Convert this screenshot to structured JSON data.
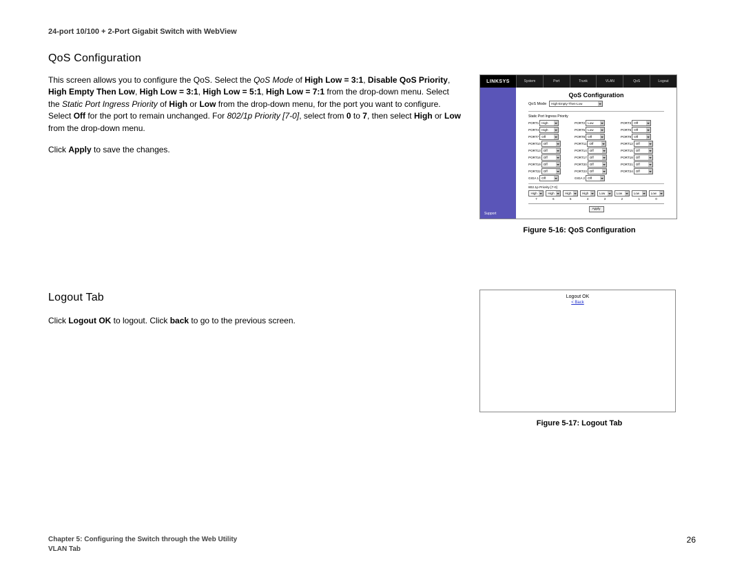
{
  "doc_title": "24-port 10/100 + 2-Port Gigabit Switch with WebView",
  "section1": {
    "heading": "QoS Configuration",
    "p_a": "This screen allows you to configure the QoS. Select the ",
    "p_b": "QoS Mode",
    "p_c": " of ",
    "p_d": "High Low = 3:1",
    "p_e": ", ",
    "p_f": "Disable QoS Priority",
    "p_g": ", ",
    "p_h": "High Empty Then Low",
    "p_i": ", ",
    "p_j": "High Low = 3:1",
    "p_k": ", ",
    "p_l": "High Low = 5:1",
    "p_m": ", ",
    "p_n": "High Low = 7:1",
    "p_o": " from the drop-down menu. Select the ",
    "p_p": "Static Port Ingress Priority",
    "p_q": " of ",
    "p_r": "High",
    "p_s": " or ",
    "p_t": "Low",
    "p_u": " from the drop-down menu, for the port you want to configure. Select ",
    "p_v": "Off",
    "p_w": " for the port to remain unchanged. For ",
    "p_x": "802/1p Priority [7-0]",
    "p_y": ", select from ",
    "p_z": "0",
    "p_aa": " to ",
    "p_ab": "7",
    "p_ac": ", then select ",
    "p_ad": "High",
    "p_ae": " or ",
    "p_af": "Low",
    "p_ag": " from the drop-down menu.",
    "click_a": "Click ",
    "click_b": "Apply",
    "click_c": " to save the changes."
  },
  "fig1": {
    "caption": "Figure 5-16: QoS Configuration",
    "logo": "LINKSYS",
    "tabs": [
      "System",
      "Port",
      "Trunk",
      "VLAN",
      "QoS",
      "Logout"
    ],
    "title": "QoS Configuration",
    "mode_label": "QoS Mode",
    "mode_value": "High-Empty-Then-Low",
    "ingress_label": "Static Port Ingress Priority",
    "ports": [
      {
        "n": "PORT1",
        "v": "High"
      },
      {
        "n": "PORT2",
        "v": "Low"
      },
      {
        "n": "PORT3",
        "v": "Off"
      },
      {
        "n": "PORT4",
        "v": "High"
      },
      {
        "n": "PORT5",
        "v": "Low"
      },
      {
        "n": "PORT6",
        "v": "Off"
      },
      {
        "n": "PORT7",
        "v": "Off"
      },
      {
        "n": "PORT8",
        "v": "Off"
      },
      {
        "n": "PORT9",
        "v": "Off"
      },
      {
        "n": "PORT10",
        "v": "Off"
      },
      {
        "n": "PORT11",
        "v": "Off"
      },
      {
        "n": "PORT12",
        "v": "Off"
      },
      {
        "n": "PORT13",
        "v": "Off"
      },
      {
        "n": "PORT14",
        "v": "Off"
      },
      {
        "n": "PORT15",
        "v": "Off"
      },
      {
        "n": "PORT16",
        "v": "Off"
      },
      {
        "n": "PORT17",
        "v": "Off"
      },
      {
        "n": "PORT18",
        "v": "Off"
      },
      {
        "n": "PORT19",
        "v": "Off"
      },
      {
        "n": "PORT20",
        "v": "Off"
      },
      {
        "n": "PORT21",
        "v": "Off"
      },
      {
        "n": "PORT22",
        "v": "Off"
      },
      {
        "n": "PORT23",
        "v": "Off"
      },
      {
        "n": "PORT24",
        "v": "Off"
      },
      {
        "n": "GIGA 1",
        "v": "Off"
      },
      {
        "n": "GIGA 2",
        "v": "Off"
      }
    ],
    "priority_label": "802.1p Priority [7-0]",
    "priorities": [
      {
        "n": "7",
        "v": "High"
      },
      {
        "n": "6",
        "v": "High"
      },
      {
        "n": "5",
        "v": "High"
      },
      {
        "n": "4",
        "v": "High"
      },
      {
        "n": "3",
        "v": "Low"
      },
      {
        "n": "2",
        "v": "Low"
      },
      {
        "n": "1",
        "v": "Low"
      },
      {
        "n": "0",
        "v": "Low"
      }
    ],
    "apply": "Apply",
    "support": "Support"
  },
  "section2": {
    "heading": "Logout Tab",
    "p_a": "Click ",
    "p_b": "Logout OK",
    "p_c": " to logout. Click ",
    "p_d": "back",
    "p_e": " to go to the previous screen."
  },
  "fig2": {
    "caption": "Figure 5-17: Logout Tab",
    "text": "Logout OK",
    "link": "< Back"
  },
  "footer": {
    "chapter": "Chapter 5: Configuring the Switch through the Web Utility",
    "sub": "VLAN Tab",
    "page": "26"
  }
}
